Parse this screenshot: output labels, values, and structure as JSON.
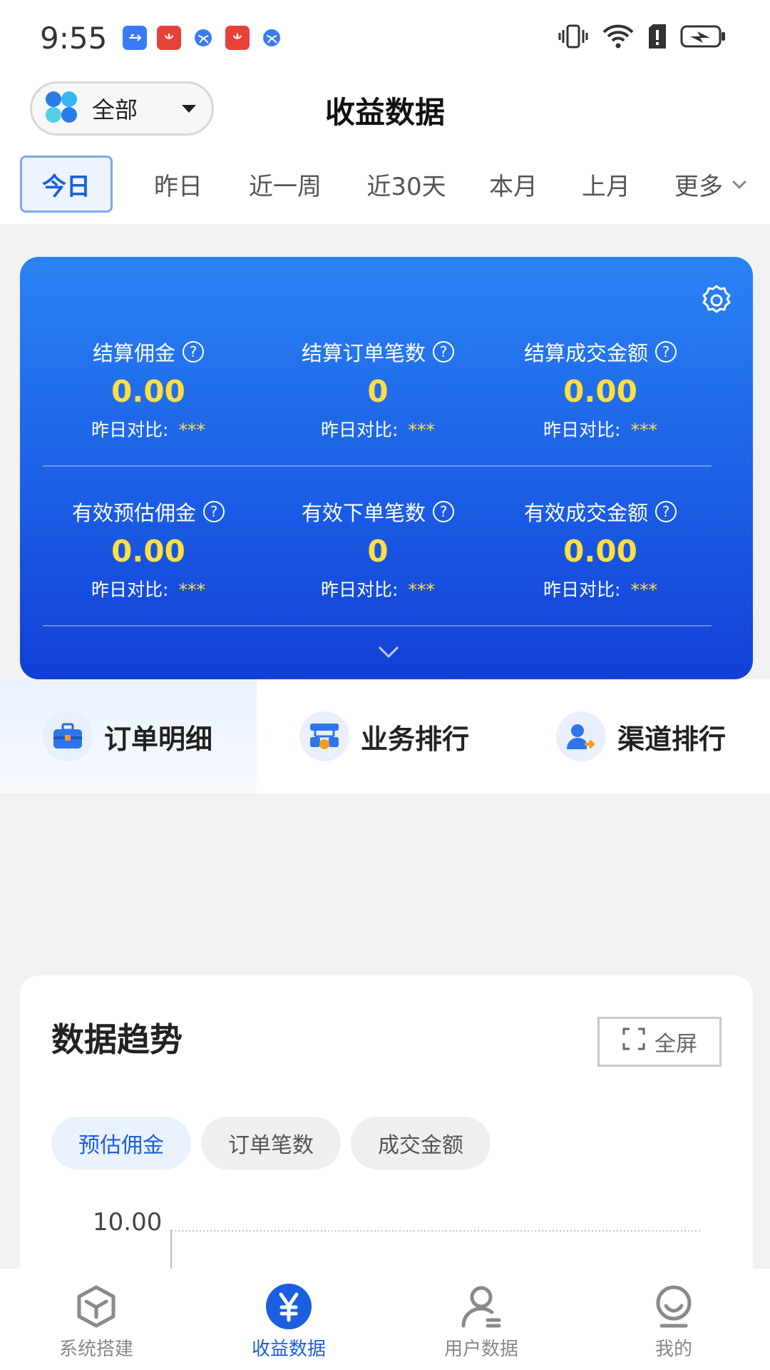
{
  "status_bar": {
    "time": "9:55"
  },
  "header": {
    "scope_label": "全部",
    "title": "收益数据"
  },
  "date_tabs": [
    "今日",
    "昨日",
    "近一周",
    "近30天",
    "本月",
    "上月",
    "更多"
  ],
  "stats": {
    "row1": [
      {
        "label": "结算佣金",
        "value": "0.00",
        "compare_label": "昨日对比:",
        "compare_value": "***"
      },
      {
        "label": "结算订单笔数",
        "value": "0",
        "compare_label": "昨日对比:",
        "compare_value": "***"
      },
      {
        "label": "结算成交金额",
        "value": "0.00",
        "compare_label": "昨日对比:",
        "compare_value": "***"
      }
    ],
    "row2": [
      {
        "label": "有效预估佣金",
        "value": "0.00",
        "compare_label": "昨日对比:",
        "compare_value": "***"
      },
      {
        "label": "有效下单笔数",
        "value": "0",
        "compare_label": "昨日对比:",
        "compare_value": "***"
      },
      {
        "label": "有效成交金额",
        "value": "0.00",
        "compare_label": "昨日对比:",
        "compare_value": "***"
      }
    ],
    "help_glyph": "?"
  },
  "feature_tabs": [
    "订单明细",
    "业务排行",
    "渠道排行"
  ],
  "trend": {
    "title": "数据趋势",
    "fullscreen_label": "全屏",
    "metrics": [
      "预估佣金",
      "订单笔数",
      "成交金额"
    ],
    "y_tick": "10.00"
  },
  "bottom_nav": [
    "系统搭建",
    "收益数据",
    "用户数据",
    "我的"
  ],
  "colors": {
    "accent": "#1b5fe0",
    "highlight": "#ffe040",
    "card_top": "#2a83f4",
    "card_bottom": "#123fd6"
  }
}
